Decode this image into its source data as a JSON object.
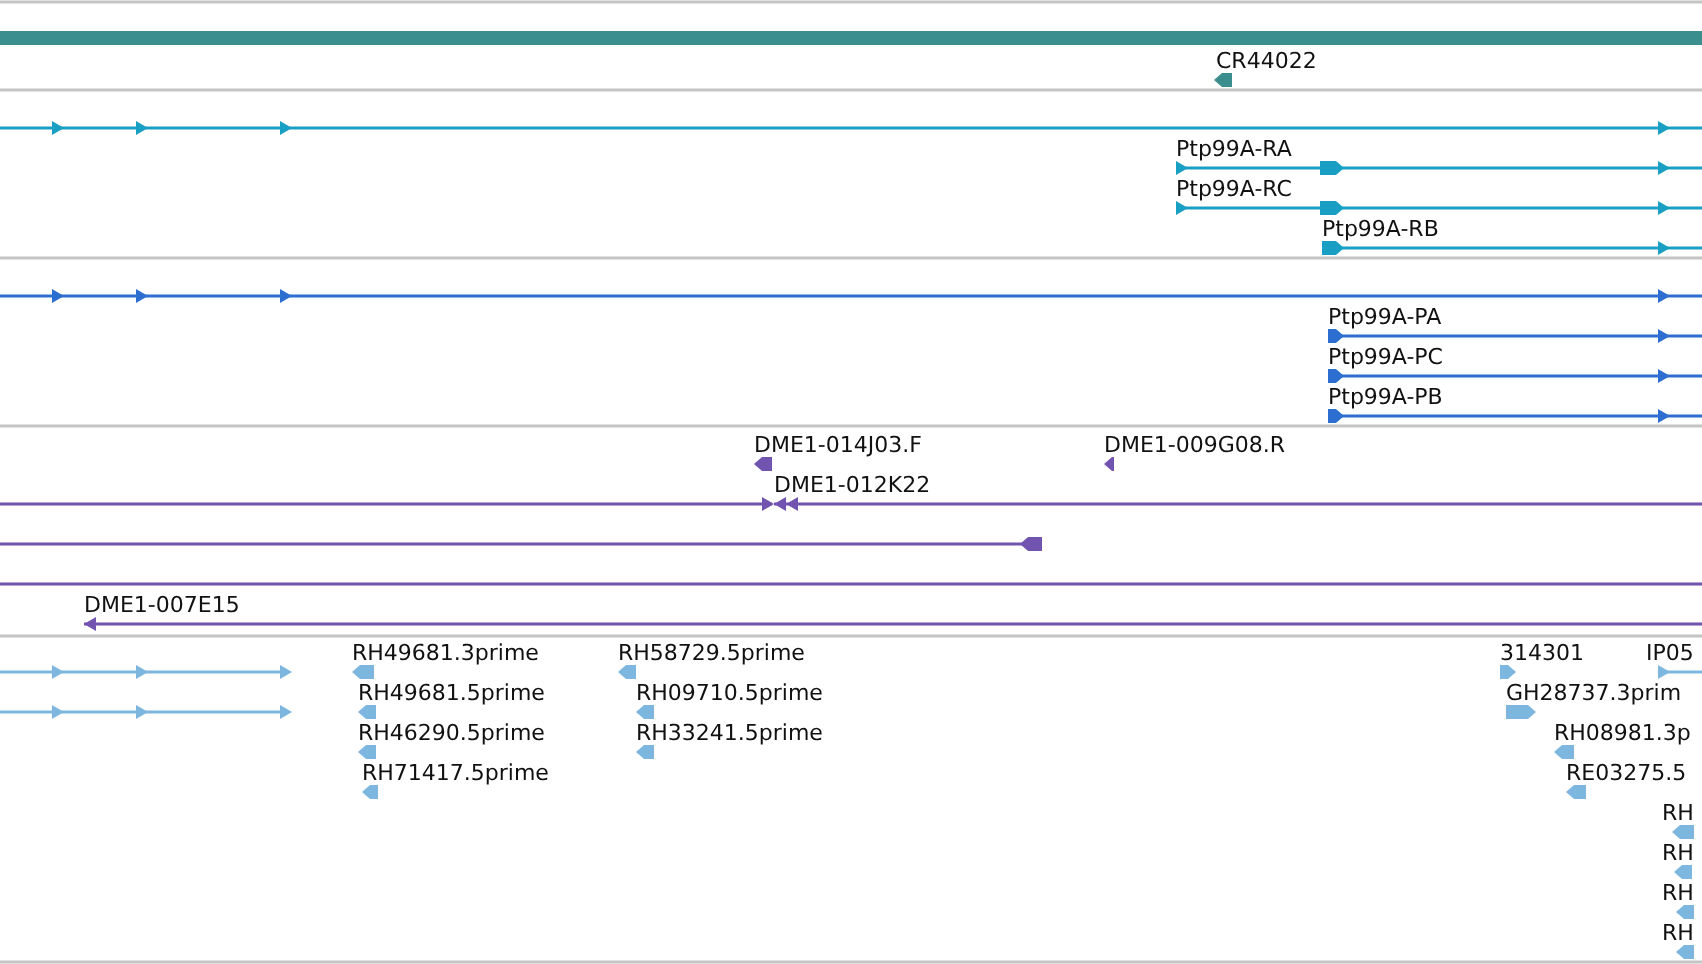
{
  "tracks": [
    {
      "color": "#3b8e8e",
      "features": [
        {
          "kind": "bar"
        },
        {
          "kind": "glyph",
          "label": "CR44022",
          "reverse": true
        }
      ]
    },
    {
      "color": "#1a9fc4",
      "features": [
        {
          "kind": "line",
          "reverse": false
        },
        {
          "kind": "line",
          "label": "Ptp99A-RA",
          "reverse": false
        },
        {
          "kind": "line",
          "label": "Ptp99A-RC",
          "reverse": false
        },
        {
          "kind": "line",
          "label": "Ptp99A-RB",
          "reverse": false
        }
      ]
    },
    {
      "color": "#2d6fd1",
      "features": [
        {
          "kind": "line",
          "reverse": false
        },
        {
          "kind": "line",
          "label": "Ptp99A-PA",
          "reverse": false
        },
        {
          "kind": "line",
          "label": "Ptp99A-PC",
          "reverse": false
        },
        {
          "kind": "line",
          "label": "Ptp99A-PB",
          "reverse": false
        }
      ]
    },
    {
      "color": "#7153b0",
      "features": [
        {
          "kind": "glyph",
          "label": "DME1-014J03.F",
          "reverse": true
        },
        {
          "kind": "glyph",
          "label": "DME1-009G08.R",
          "reverse": true
        },
        {
          "kind": "line",
          "reverse": false
        },
        {
          "kind": "line",
          "label": "DME1-012K22",
          "reverse": true
        },
        {
          "kind": "line",
          "reverse": true
        },
        {
          "kind": "line"
        },
        {
          "kind": "line",
          "label": "DME1-007E15",
          "reverse": true
        }
      ]
    },
    {
      "color": "#7db7df",
      "features": [
        {
          "kind": "line",
          "reverse": false
        },
        {
          "kind": "line",
          "reverse": false
        },
        {
          "kind": "glyph",
          "label": "RH49681.3prime",
          "reverse": true
        },
        {
          "kind": "glyph",
          "label": "RH49681.5prime",
          "reverse": true
        },
        {
          "kind": "glyph",
          "label": "RH46290.5prime",
          "reverse": true
        },
        {
          "kind": "glyph",
          "label": "RH71417.5prime",
          "reverse": true
        },
        {
          "kind": "glyph",
          "label": "RH58729.5prime",
          "reverse": true
        },
        {
          "kind": "glyph",
          "label": "RH09710.5prime",
          "reverse": true
        },
        {
          "kind": "glyph",
          "label": "RH33241.5prime",
          "reverse": true
        },
        {
          "kind": "glyph",
          "label": "314301",
          "reverse": false
        },
        {
          "kind": "line",
          "label": "IP05",
          "reverse": false
        },
        {
          "kind": "glyph",
          "label": "GH28737.3prim",
          "reverse": false
        },
        {
          "kind": "glyph",
          "label": "RH08981.3p",
          "reverse": true
        },
        {
          "kind": "glyph",
          "label": "RE03275.5",
          "reverse": true
        },
        {
          "kind": "glyph",
          "label": "RH",
          "reverse": true
        },
        {
          "kind": "glyph",
          "label": "RH",
          "reverse": true
        },
        {
          "kind": "glyph",
          "label": "RH",
          "reverse": true
        },
        {
          "kind": "glyph",
          "label": "RH",
          "reverse": true
        }
      ]
    }
  ]
}
